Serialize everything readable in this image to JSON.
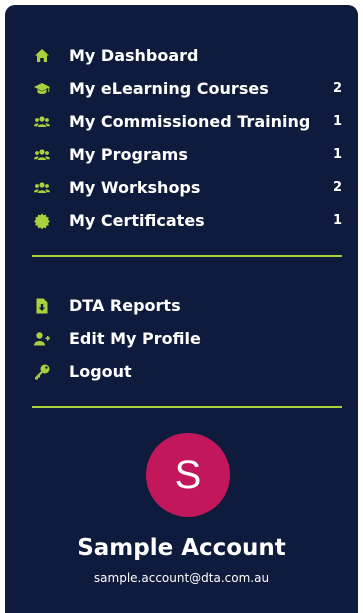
{
  "menu": {
    "primary": [
      {
        "label": "My Dashboard",
        "count": "",
        "icon": "home-icon"
      },
      {
        "label": "My eLearning Courses",
        "count": "2",
        "icon": "graduation-cap-icon"
      },
      {
        "label": "My Commissioned Training",
        "count": "1",
        "icon": "users-icon"
      },
      {
        "label": "My Programs",
        "count": "1",
        "icon": "users-icon"
      },
      {
        "label": "My Workshops",
        "count": "2",
        "icon": "users-icon"
      },
      {
        "label": "My Certificates",
        "count": "1",
        "icon": "certificate-icon"
      }
    ],
    "secondary": [
      {
        "label": "DTA Reports",
        "icon": "file-download-icon"
      },
      {
        "label": "Edit My Profile",
        "icon": "user-plus-icon"
      },
      {
        "label": "Logout",
        "icon": "key-icon"
      }
    ]
  },
  "account": {
    "avatar_initial": "S",
    "name": "Sample Account",
    "email": "sample.account@dta.com.au"
  },
  "colors": {
    "panel_background": "#0f1b3d",
    "accent": "#a8d13d",
    "avatar_background": "#c2185b",
    "text": "#ffffff"
  }
}
